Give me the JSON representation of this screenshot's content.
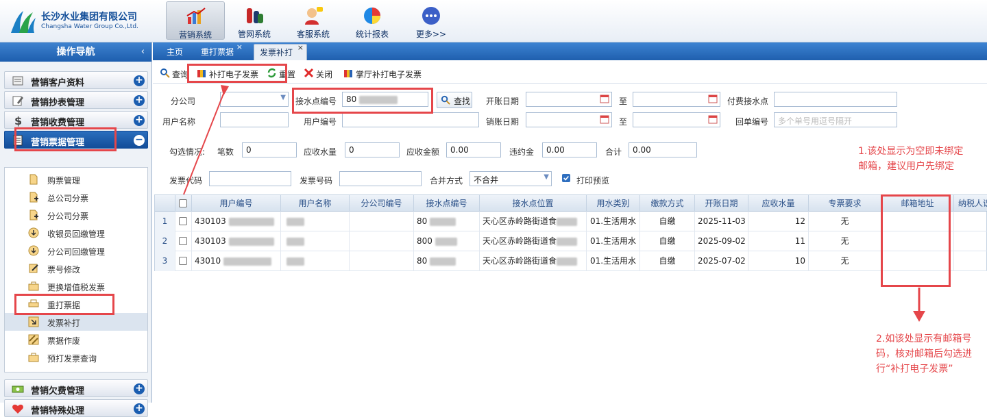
{
  "header": {
    "company_cn": "长沙水业集团有限公司",
    "company_en": "Changsha Water Group Co.,Ltd.",
    "systems": [
      {
        "label": "营销系统",
        "icon": "marketing-system-icon",
        "active": true
      },
      {
        "label": "管网系统",
        "icon": "pipe-network-icon",
        "active": false
      },
      {
        "label": "客服系统",
        "icon": "customer-service-icon",
        "active": false
      },
      {
        "label": "统计报表",
        "icon": "statistics-report-icon",
        "active": false
      },
      {
        "label": "更多>>",
        "icon": "more-icon",
        "active": false
      }
    ]
  },
  "sidebar": {
    "title": "操作导航",
    "collapse_glyph": "‹",
    "groups": [
      {
        "label": "营销客户资料",
        "toggle": "+"
      },
      {
        "label": "营销抄表管理",
        "toggle": "+"
      },
      {
        "label": "营销收费管理",
        "toggle": "+"
      },
      {
        "label": "营销票据管理",
        "toggle": "−"
      },
      {
        "label": "营销欠费管理",
        "toggle": "+"
      },
      {
        "label": "营销特殊处理",
        "toggle": "+"
      }
    ],
    "sub_items": [
      {
        "label": "购票管理"
      },
      {
        "label": "总公司分票"
      },
      {
        "label": "分公司分票"
      },
      {
        "label": "收银员回缴管理"
      },
      {
        "label": "分公司回缴管理"
      },
      {
        "label": "票号修改"
      },
      {
        "label": "更换增值税发票"
      },
      {
        "label": "重打票据"
      },
      {
        "label": "发票补打"
      },
      {
        "label": "票据作废"
      },
      {
        "label": "预打发票查询"
      }
    ]
  },
  "tabs": [
    {
      "label": "主页",
      "closable": false
    },
    {
      "label": "重打票据",
      "closable": true
    },
    {
      "label": "发票补打",
      "closable": true
    }
  ],
  "toolbar": {
    "query": "查询",
    "reprint_e_invoice": "补打电子发票",
    "reset": "重置",
    "close": "关闭",
    "app_reprint": "掌厅补打电子发票"
  },
  "form": {
    "branch_label": "分公司",
    "branch_value": "",
    "point_no_label": "接水点编号",
    "point_no_value": "80",
    "find_button": "查找",
    "open_date_label": "开账日期",
    "open_date_from": "",
    "to_label": "至",
    "open_date_to": "",
    "pay_point_label": "付费接水点",
    "pay_point_value": "",
    "user_name_label": "用户名称",
    "user_name_value": "",
    "user_no_label": "用户编号",
    "user_no_value": "",
    "cancel_date_label": "销账日期",
    "cancel_date_from": "",
    "cancel_date_to": "",
    "receipt_no_label": "回单编号",
    "receipt_no_placeholder": "多个单号用逗号隔开",
    "summary_label": "勾选情况:",
    "count_label": "笔数",
    "count_value": "0",
    "water_qty_label": "应收水量",
    "water_qty_value": "0",
    "amount_label": "应收金额",
    "amount_value": "0.00",
    "penalty_label": "违约金",
    "penalty_value": "0.00",
    "total_label": "合计",
    "total_value": "0.00",
    "invoice_code_label": "发票代码",
    "invoice_code_value": "",
    "invoice_no_label": "发票号码",
    "invoice_no_value": "",
    "merge_label": "合并方式",
    "merge_value": "不合并",
    "print_preview_label": "打印预览",
    "print_preview_checked": true
  },
  "grid": {
    "columns": [
      "用户编号",
      "用户名称",
      "分公司编号",
      "接水点编号",
      "接水点位置",
      "用水类别",
      "缴款方式",
      "开账日期",
      "应收水量",
      "专票要求",
      "邮箱地址",
      "纳税人识"
    ],
    "rows": [
      {
        "num": "1",
        "user_no": "430103",
        "user_name": "",
        "branch_no": "",
        "point_no": "80",
        "location": "天心区赤岭路街道食",
        "water_type": "01.生活用水",
        "pay_mode": "自缴",
        "open_date": "2025-11-03",
        "water_qty": "12",
        "special_invoice": "无",
        "email": "",
        "taxpayer": ""
      },
      {
        "num": "2",
        "user_no": "430103",
        "user_name": "",
        "branch_no": "",
        "point_no": "800",
        "location": "天心区赤岭路街道食",
        "water_type": "01.生活用水",
        "pay_mode": "自缴",
        "open_date": "2025-09-02",
        "water_qty": "11",
        "special_invoice": "无",
        "email": "",
        "taxpayer": ""
      },
      {
        "num": "3",
        "user_no": "43010",
        "user_name": "",
        "branch_no": "",
        "point_no": "80",
        "location": "天心区赤岭路街道食",
        "water_type": "01.生活用水",
        "pay_mode": "自缴",
        "open_date": "2025-07-02",
        "water_qty": "10",
        "special_invoice": "无",
        "email": "",
        "taxpayer": ""
      }
    ]
  },
  "annotations": {
    "note1": "1.该处显示为空即未绑定邮箱，建议用户先绑定",
    "note2": "2.如该处显示有邮箱号码，核对邮箱后勾选进行“补打电子发票”"
  },
  "colors": {
    "highlight": "#e5464a",
    "brand": "#1d5eae"
  }
}
